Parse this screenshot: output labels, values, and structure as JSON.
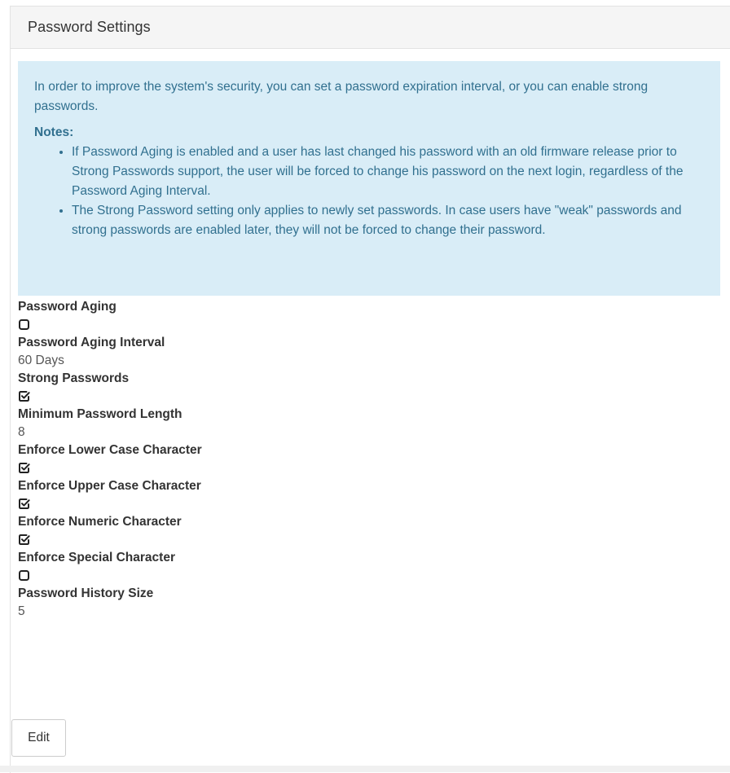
{
  "panel": {
    "title": "Password Settings"
  },
  "info": {
    "intro": "In order to improve the system's security, you can set a password expiration interval, or you can enable strong passwords.",
    "notes_title": "Notes:",
    "notes": [
      "If Password Aging is enabled and a user has last changed his password with an old firmware release prior to Strong Passwords support, the user will be forced to change his password on the next login, regardless of the Password Aging Interval.",
      "The Strong Password setting only applies to newly set passwords. In case users have \"weak\" passwords and strong passwords are enabled later, they will not be forced to change their password."
    ]
  },
  "fields": {
    "password_aging": {
      "label": "Password Aging",
      "checked": false
    },
    "password_aging_interval": {
      "label": "Password Aging Interval",
      "value": "60 Days"
    },
    "strong_passwords": {
      "label": "Strong Passwords",
      "checked": true
    },
    "minimum_password_length": {
      "label": "Minimum Password Length",
      "value": "8"
    },
    "enforce_lower_case": {
      "label": "Enforce Lower Case Character",
      "checked": true
    },
    "enforce_upper_case": {
      "label": "Enforce Upper Case Character",
      "checked": true
    },
    "enforce_numeric": {
      "label": "Enforce Numeric Character",
      "checked": true
    },
    "enforce_special": {
      "label": "Enforce Special Character",
      "checked": false
    },
    "password_history_size": {
      "label": "Password History Size",
      "value": "5"
    }
  },
  "actions": {
    "edit_label": "Edit"
  },
  "icons": {
    "checked": "checkbox-checked-icon",
    "unchecked": "checkbox-unchecked-icon"
  },
  "colors": {
    "info_background": "#d9edf7",
    "info_text": "#31708f",
    "header_background": "#f5f5f5"
  }
}
